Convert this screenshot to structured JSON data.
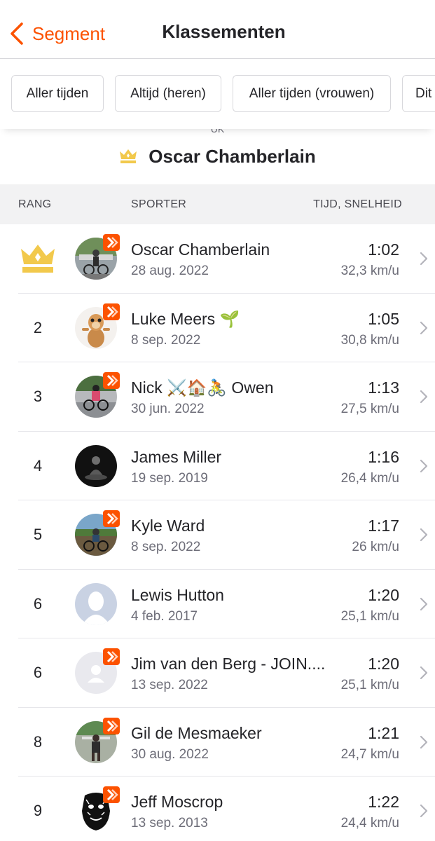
{
  "nav": {
    "back_label": "Segment",
    "title": "Klassementen"
  },
  "filters": [
    {
      "label": "Aller tijden",
      "active": true
    },
    {
      "label": "Altijd (heren)",
      "active": false
    },
    {
      "label": "Aller tijden (vrouwen)",
      "active": false
    },
    {
      "label": "Dit",
      "active": false
    }
  ],
  "kom": {
    "partial_label": "UK",
    "holder": "Oscar Chamberlain"
  },
  "columns": {
    "rank": "RANG",
    "athlete": "SPORTER",
    "time_speed": "TIJD, SNELHEID"
  },
  "colors": {
    "accent": "#fc5200",
    "crown": "#f2c94c"
  },
  "rows": [
    {
      "rank": "",
      "crown": true,
      "name": "Oscar Chamberlain",
      "date": "28 aug. 2022",
      "time": "1:02",
      "speed": "32,3 km/u",
      "subscriber": true,
      "avatar": "photo-cyclist"
    },
    {
      "rank": "2",
      "crown": false,
      "name": "Luke Meers 🌱",
      "date": "8 sep. 2022",
      "time": "1:05",
      "speed": "30,8 km/u",
      "subscriber": true,
      "avatar": "cartoon-meerkat"
    },
    {
      "rank": "3",
      "crown": false,
      "name": "Nick ⚔️🏠🚴 Owen",
      "date": "30 jun. 2022",
      "time": "1:13",
      "speed": "27,5 km/u",
      "subscriber": true,
      "avatar": "photo-road-cyclist"
    },
    {
      "rank": "4",
      "crown": false,
      "name": "James Miller",
      "date": "19 sep. 2019",
      "time": "1:16",
      "speed": "26,4 km/u",
      "subscriber": false,
      "avatar": "photo-meditating-figure"
    },
    {
      "rank": "5",
      "crown": false,
      "name": "Kyle Ward",
      "date": "8 sep. 2022",
      "time": "1:17",
      "speed": "26 km/u",
      "subscriber": true,
      "avatar": "photo-mtb-rider"
    },
    {
      "rank": "6",
      "crown": false,
      "name": "Lewis Hutton",
      "date": "4 feb. 2017",
      "time": "1:20",
      "speed": "25,1 km/u",
      "subscriber": false,
      "avatar": "default-silhouette"
    },
    {
      "rank": "6",
      "crown": false,
      "name": "Jim van den Berg - JOIN....",
      "date": "13 sep. 2022",
      "time": "1:20",
      "speed": "25,1 km/u",
      "subscriber": true,
      "avatar": "default-person"
    },
    {
      "rank": "8",
      "crown": false,
      "name": "Gil de Mesmaeker",
      "date": "30 aug. 2022",
      "time": "1:21",
      "speed": "24,7 km/u",
      "subscriber": true,
      "avatar": "photo-runner"
    },
    {
      "rank": "9",
      "crown": false,
      "name": "Jeff Moscrop",
      "date": "13 sep. 2013",
      "time": "1:22",
      "speed": "24,4 km/u",
      "subscriber": true,
      "avatar": "chewbacca"
    }
  ]
}
